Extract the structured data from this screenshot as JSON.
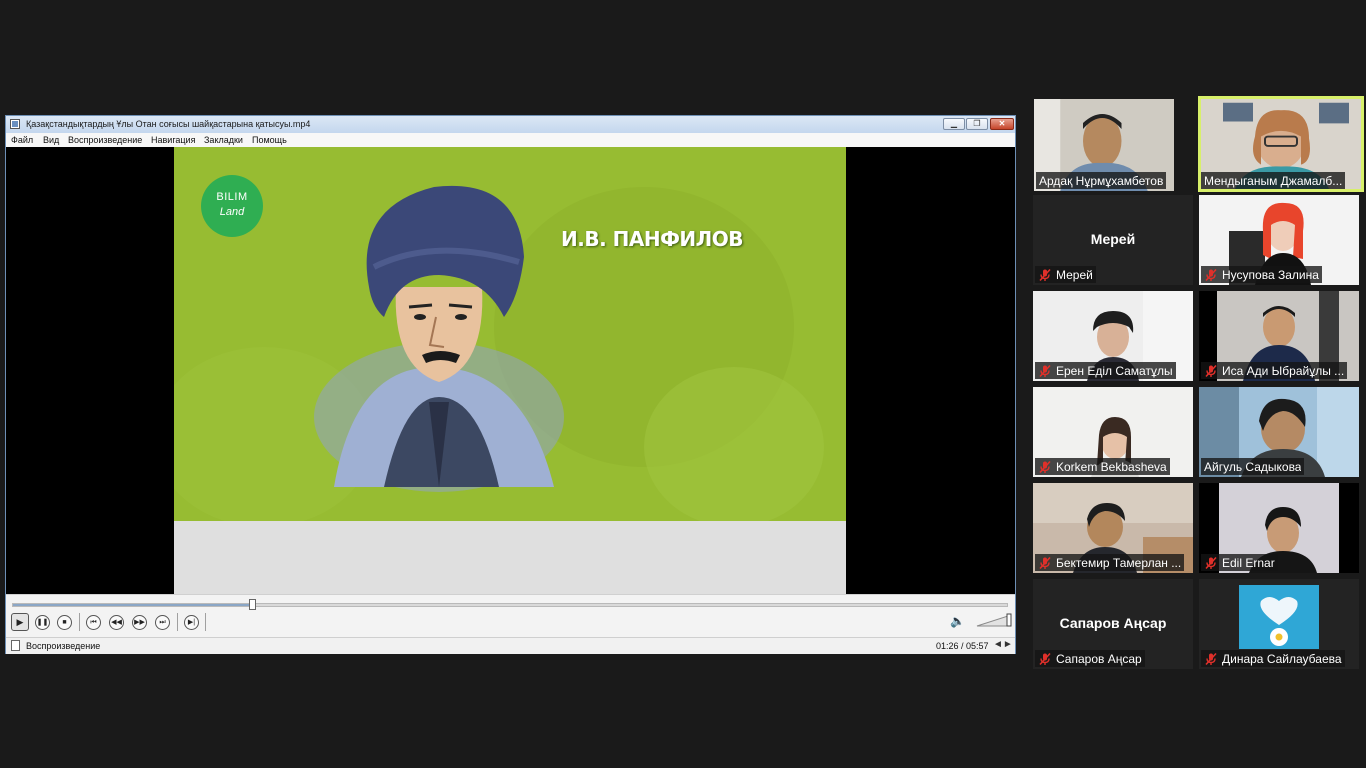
{
  "player": {
    "title": "Қазақстандықтардың Ұлы Отан соғысы шайқастарына қатысуы.mp4",
    "menu": [
      "Файл",
      "Вид",
      "Воспроизведение",
      "Навигация",
      "Закладки",
      "Помощь"
    ],
    "video": {
      "logo_line1": "BILIM",
      "logo_line2": "Land",
      "caption": "И.В. ПАНФИЛОВ"
    },
    "progress_fraction": 0.24,
    "status_text": "Воспроизведение",
    "time": "01:26 / 05:57"
  },
  "participants": [
    {
      "name": "Ардақ Нұрмұхамбетов",
      "muted": false,
      "video": true,
      "active": false
    },
    {
      "name": "Мендыганым Джамалб...",
      "muted": false,
      "video": true,
      "active": true
    },
    {
      "name": "Мерей",
      "display": "Мерей",
      "muted": true,
      "video": false,
      "active": false
    },
    {
      "name": "Нусупова Залина",
      "muted": true,
      "video": true,
      "active": false
    },
    {
      "name": "Ерен Еділ Саматұлы",
      "muted": true,
      "video": true,
      "active": false
    },
    {
      "name": "Иса Ади Ыбрайұлы ...",
      "muted": true,
      "video": true,
      "active": false
    },
    {
      "name": "Korkem Bekbasheva",
      "muted": true,
      "video": true,
      "active": false
    },
    {
      "name": "Айгуль Садыкова",
      "muted": false,
      "video": true,
      "active": false
    },
    {
      "name": "Бектемир Тамерлан ...",
      "muted": true,
      "video": true,
      "active": false
    },
    {
      "name": "Edil Ernar",
      "muted": true,
      "video": true,
      "active": false
    },
    {
      "name": "Сапаров Аңсар",
      "display": "Сапаров Аңсар",
      "muted": true,
      "video": false,
      "active": false
    },
    {
      "name": "Динара Сайлаубаева",
      "muted": true,
      "video": true,
      "active": false
    }
  ],
  "colors": {
    "video_green": "#97bc32",
    "logo_green": "#2fae52",
    "active_speaker_border": "#d8f06a",
    "mute_red": "#e0302a"
  }
}
